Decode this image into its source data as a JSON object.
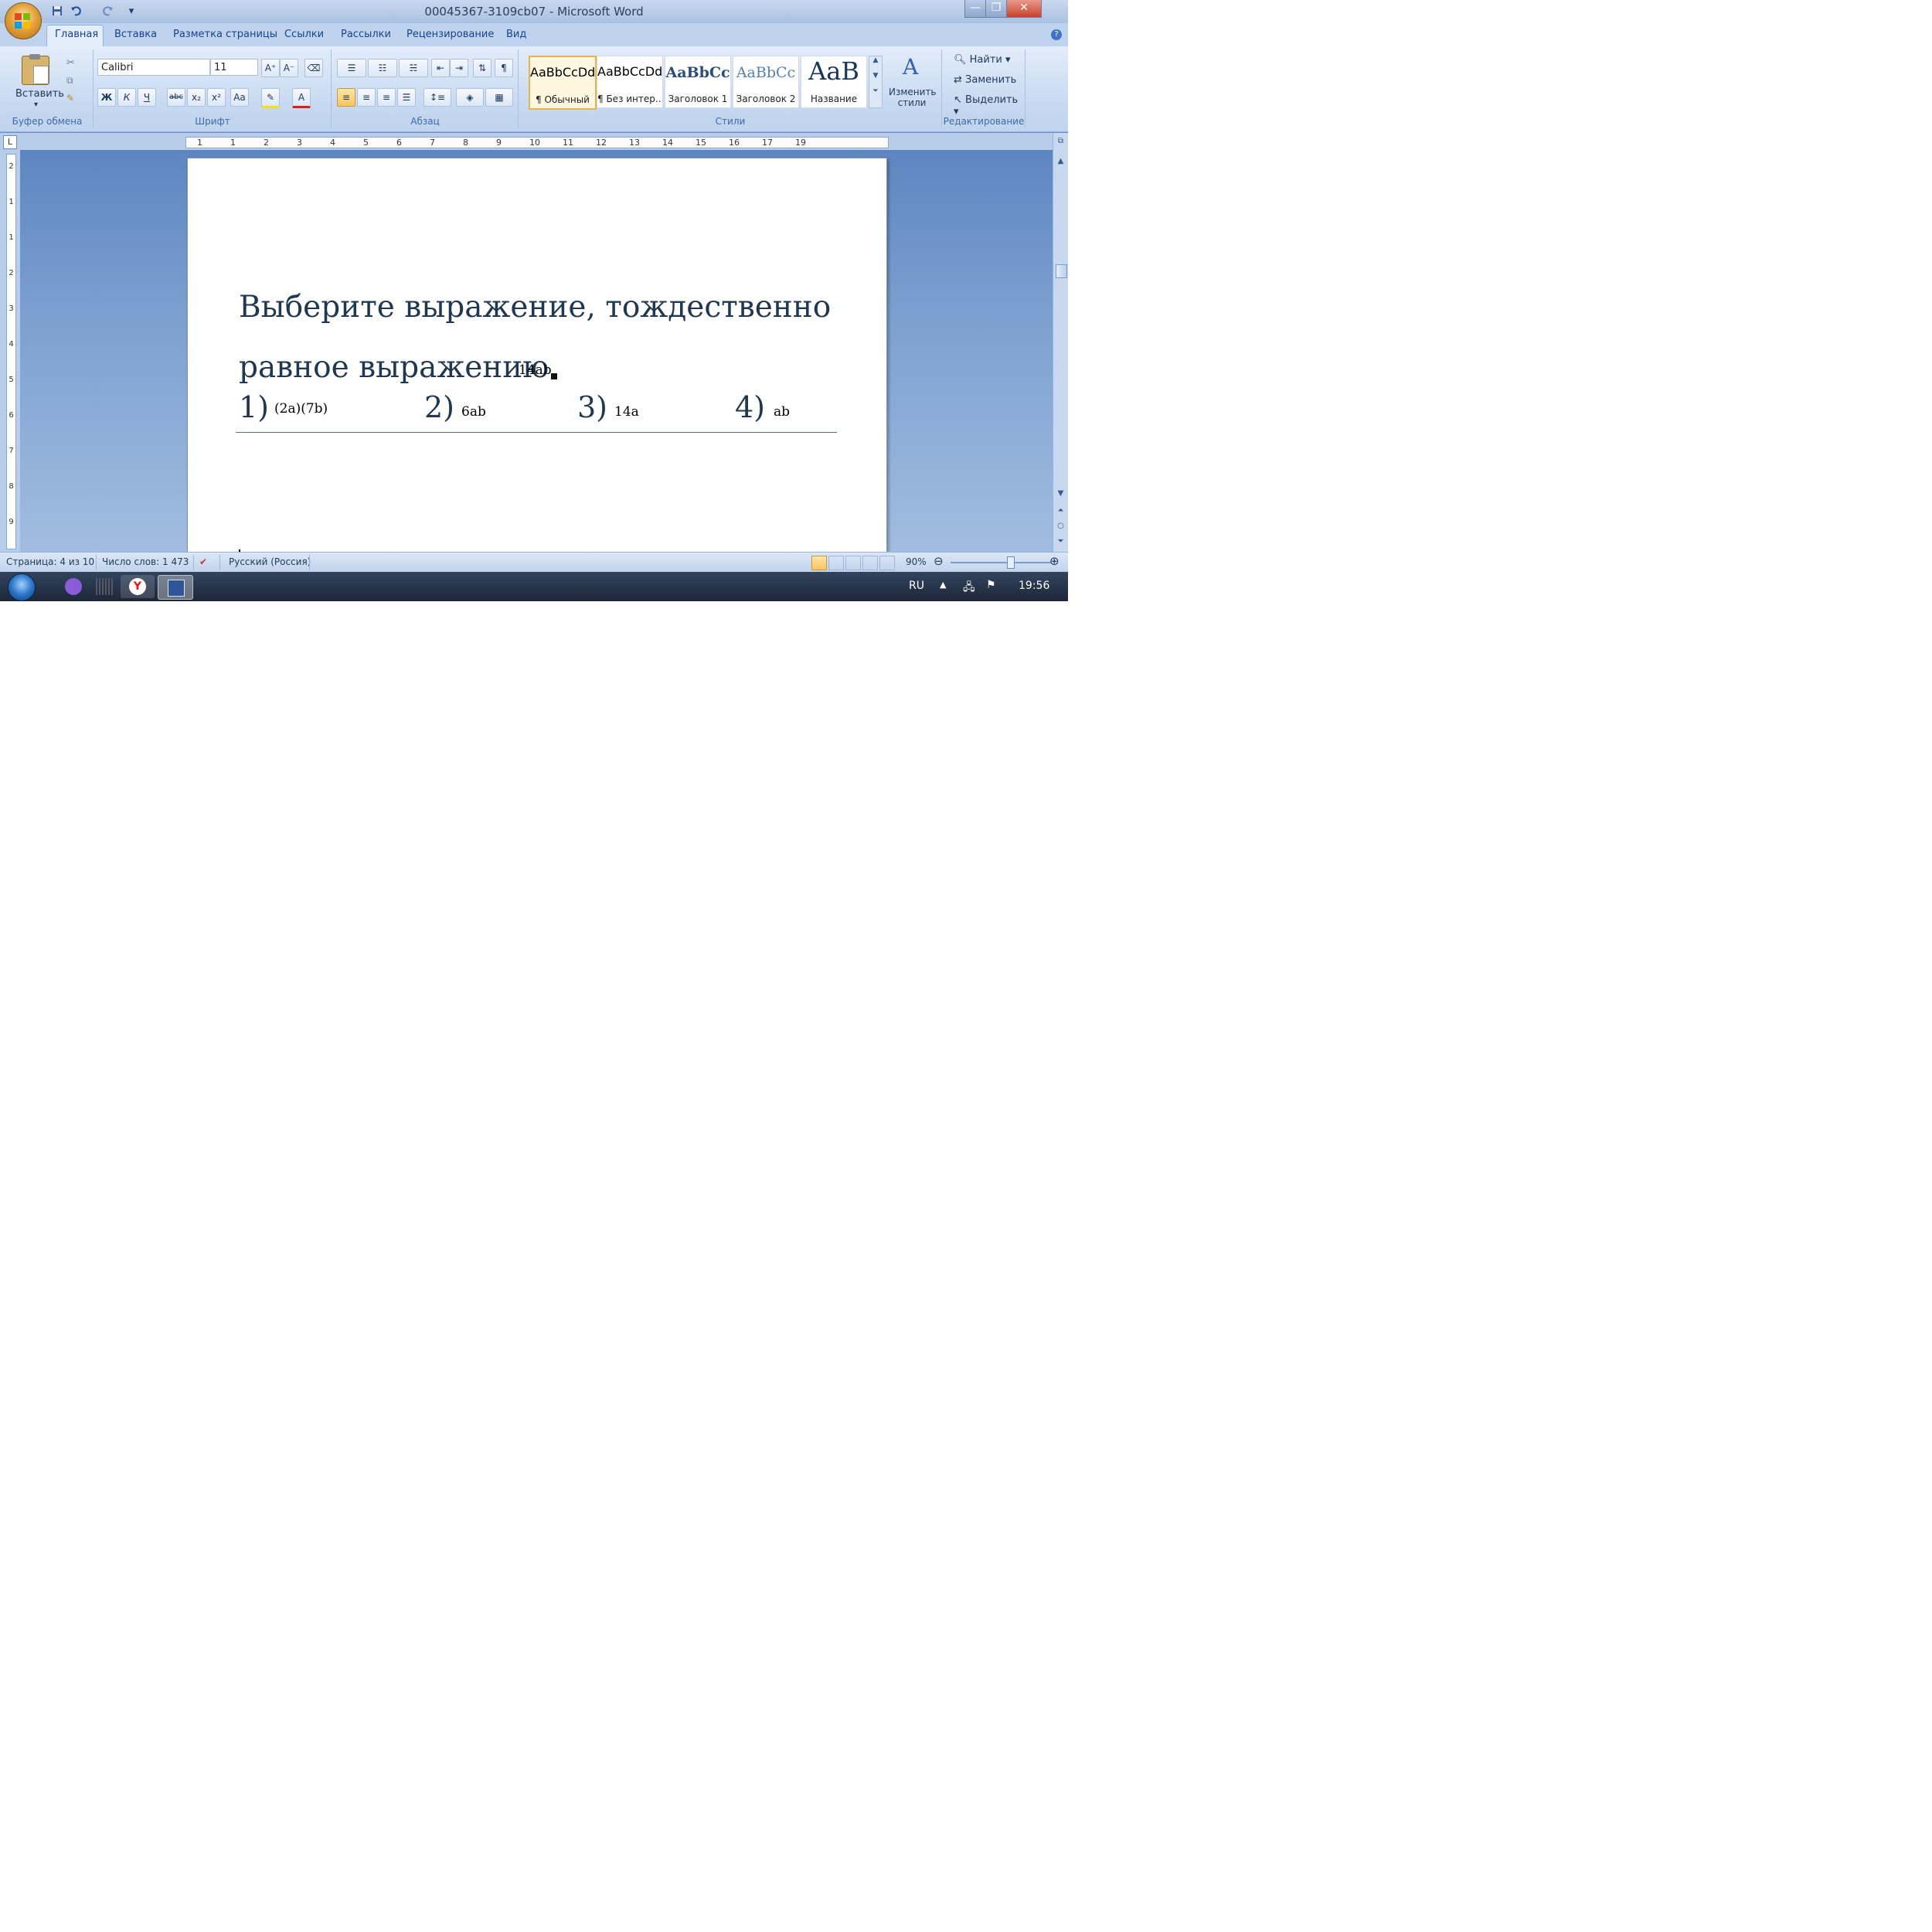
{
  "window": {
    "title": "00045367-3109cb07 - Microsoft Word",
    "minimize_glyph": "—",
    "restore_glyph": "❐",
    "close_glyph": "✕"
  },
  "quick_access": {
    "save_icon": "save-icon",
    "undo_icon": "undo-icon",
    "redo_icon": "redo-icon",
    "customize_glyph": "▾"
  },
  "tabs": [
    "Главная",
    "Вставка",
    "Разметка страницы",
    "Ссылки",
    "Рассылки",
    "Рецензирование",
    "Вид"
  ],
  "ribbon": {
    "clipboard": {
      "paste_label": "Вставить",
      "group_label": "Буфер обмена"
    },
    "font": {
      "font_name": "Calibri",
      "font_size": "11",
      "group_label": "Шрифт",
      "bold": "Ж",
      "italic": "К",
      "underline": "Ч",
      "strike": "abc",
      "subscript": "x₂",
      "superscript": "x²",
      "case": "Aa",
      "grow": "A⁺",
      "shrink": "A⁻",
      "color_a": "A"
    },
    "paragraph": {
      "group_label": "Абзац",
      "pilcrow": "¶"
    },
    "styles": {
      "group_label": "Стили",
      "items": [
        {
          "sample": "AaBbCcDd",
          "name": "¶ Обычный"
        },
        {
          "sample": "AaBbCcDd",
          "name": "¶ Без интер..."
        },
        {
          "sample": "AaBbCc",
          "name": "Заголовок 1"
        },
        {
          "sample": "AaBbCc",
          "name": "Заголовок 2"
        },
        {
          "sample": "AaB",
          "name": "Название"
        }
      ],
      "change_styles_line1": "Изменить",
      "change_styles_line2": "стили"
    },
    "editing": {
      "group_label": "Редактирование",
      "find": "Найти",
      "replace": "Заменить",
      "select": "Выделить"
    }
  },
  "ruler": {
    "h_numbers": [
      "1",
      "1",
      "2",
      "3",
      "4",
      "5",
      "6",
      "7",
      "8",
      "9",
      "10",
      "11",
      "12",
      "13",
      "14",
      "15",
      "16",
      "17",
      "19"
    ],
    "v_numbers": [
      "2",
      "1",
      "1",
      "2",
      "3",
      "4",
      "5",
      "6",
      "7",
      "8",
      "9"
    ]
  },
  "document": {
    "line1": "Выберите выражение, тождественно",
    "line2": "равное выражению",
    "expr": "14ab",
    "options": [
      {
        "num": "1)",
        "expr": "(2a)(7b)"
      },
      {
        "num": "2)",
        "expr": "6ab"
      },
      {
        "num": "3)",
        "expr": "14a"
      },
      {
        "num": "4)",
        "expr": "ab"
      }
    ]
  },
  "status": {
    "page": "Страница: 4 из 10",
    "words": "Число слов: 1 473",
    "language": "Русский (Россия)",
    "zoom": "90%"
  },
  "taskbar": {
    "lang": "RU",
    "time": "19:56"
  }
}
